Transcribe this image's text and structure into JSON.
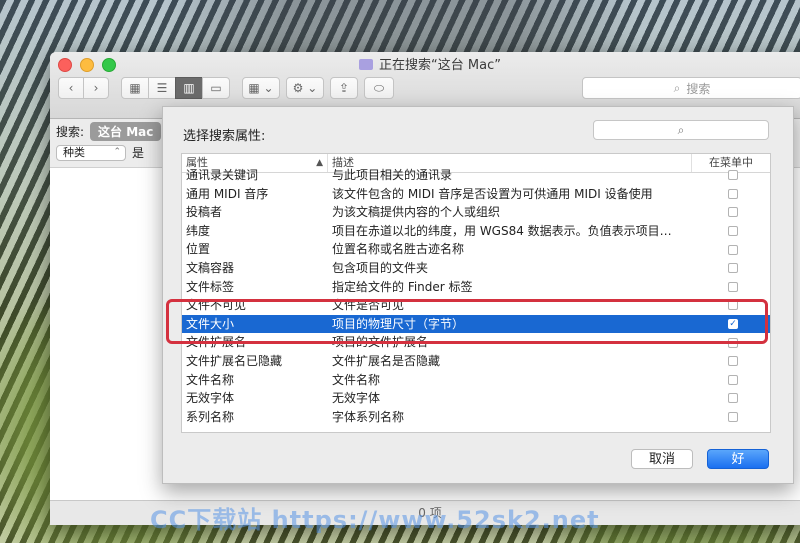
{
  "window": {
    "title": "正在搜索“这台 Mac”",
    "toolbar": {
      "back_icon": "chevron-left-icon",
      "forward_icon": "chevron-right-icon",
      "view_icons": [
        "icon-view-icon",
        "list-view-icon",
        "column-view-icon",
        "gallery-view-icon"
      ],
      "arrange_icon": "grid-arrange-icon",
      "action_icon": "gear-icon",
      "share_icon": "share-icon",
      "tag_icon": "tag-icon",
      "search_placeholder": "搜索"
    },
    "scope": {
      "label": "搜索:",
      "selected": "这台 Mac"
    },
    "criteria": {
      "attribute": "种类",
      "operator": "是"
    },
    "status": "0 项"
  },
  "sheet": {
    "title": "选择搜索属性:",
    "search_placeholder": "",
    "columns": [
      "属性",
      "描述",
      "在菜单中"
    ],
    "rows": [
      {
        "attr": "通讯录关键词",
        "desc": "与此项目相关的通讯录",
        "checked": false
      },
      {
        "attr": "通用 MIDI 音序",
        "desc": "该文件包含的 MIDI 音序是否设置为可供通用 MIDI 设备使用",
        "checked": false
      },
      {
        "attr": "投稿者",
        "desc": "为该文稿提供内容的个人或组织",
        "checked": false
      },
      {
        "attr": "纬度",
        "desc": "项目在赤道以北的纬度，用 WGS84 数据表示。负值表示项目…",
        "checked": false
      },
      {
        "attr": "位置",
        "desc": "位置名称或名胜古迹名称",
        "checked": false
      },
      {
        "attr": "文稿容器",
        "desc": "包含项目的文件夹",
        "checked": false
      },
      {
        "attr": "文件标签",
        "desc": "指定给文件的 Finder 标签",
        "checked": false
      },
      {
        "attr": "文件不可见",
        "desc": "文件是否可见",
        "checked": false
      },
      {
        "attr": "文件大小",
        "desc": "项目的物理尺寸（字节）",
        "checked": true,
        "selected": true
      },
      {
        "attr": "文件扩展名",
        "desc": "项目的文件扩展名",
        "checked": false
      },
      {
        "attr": "文件扩展名已隐藏",
        "desc": "文件扩展名是否隐藏",
        "checked": false
      },
      {
        "attr": "文件名称",
        "desc": "文件名称",
        "checked": false
      },
      {
        "attr": "无效字体",
        "desc": "无效字体",
        "checked": false
      },
      {
        "attr": "系列名称",
        "desc": "字体系列名称",
        "checked": false
      }
    ],
    "cancel_label": "取消",
    "ok_label": "好"
  },
  "watermark": "CC下载站 https://www.52sk2.net",
  "colors": {
    "selection": "#1968d2",
    "highlight": "#d4313f",
    "ok_button": "#1a6ff0"
  }
}
